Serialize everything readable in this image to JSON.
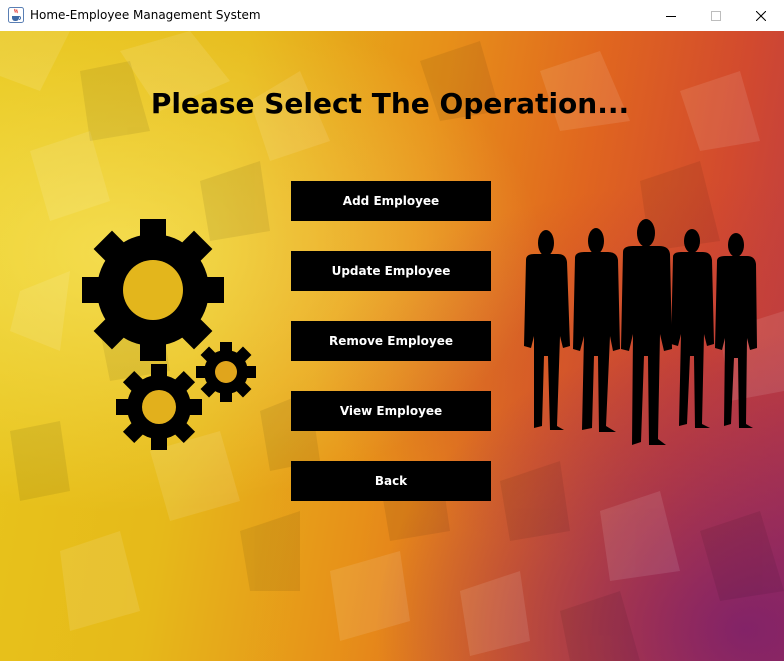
{
  "window": {
    "title": "Home-Employee Management System",
    "icon": "java-cup-icon",
    "controls": [
      "minimize-icon",
      "maximize-icon",
      "close-icon"
    ]
  },
  "main": {
    "heading": "Please Select The Operation...",
    "buttons": [
      {
        "label": "Add Employee"
      },
      {
        "label": "Update Employee"
      },
      {
        "label": "Remove Employee"
      },
      {
        "label": "View Employee"
      },
      {
        "label": "Back"
      }
    ],
    "illustrations": [
      "gears-icon",
      "business-people-silhouette"
    ]
  },
  "colors": {
    "button_bg": "#000000",
    "button_text": "#ffffff",
    "background_start": "#e8c61c",
    "background_end": "#b7384a"
  }
}
